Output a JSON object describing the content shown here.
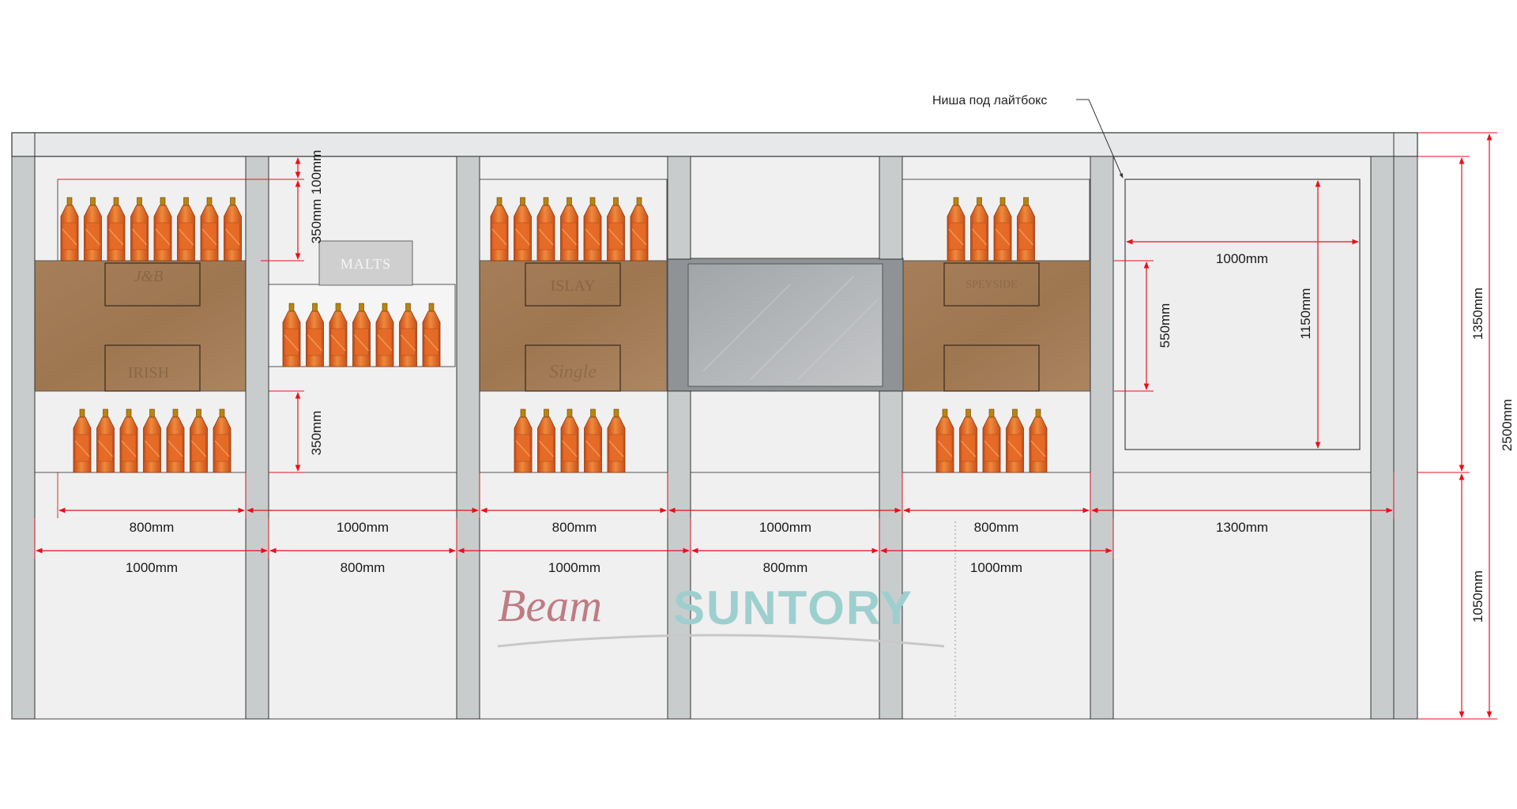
{
  "callout": {
    "text": "Ниша под лайтбокс"
  },
  "brand": {
    "beam": "Beam",
    "suntory": "SUNTORY",
    "beam_color": "#b9707a",
    "suntory_color": "#9ecfcf"
  },
  "panel_labels": {
    "jb": "J&B",
    "irish": "IRISH",
    "malts": "MALTS",
    "islay": "ISLAY",
    "speyside": "SPEYSIDE",
    "single": "Single"
  },
  "bottom_dims": {
    "row1": [
      "800mm",
      "1000mm",
      "800mm",
      "1000mm",
      "800mm",
      "1300mm"
    ],
    "row2": [
      "1000mm",
      "800mm",
      "1000mm",
      "800mm",
      "1000mm"
    ]
  },
  "vertical_dims": {
    "top_100": "100mm",
    "top_350": "350mm",
    "lower_350": "350mm",
    "niche_550": "550mm",
    "lightbox_1150": "1150mm",
    "lightbox_1000": "1000mm",
    "upper_1350": "1350mm",
    "total_2500": "2500mm",
    "lower_1050": "1050mm"
  },
  "colors": {
    "dim_red": "#e8101b",
    "frame_gray": "#c9cccd",
    "wood": "#a37d58",
    "bottle": "#e07028",
    "wall": "#f0f0f0"
  }
}
